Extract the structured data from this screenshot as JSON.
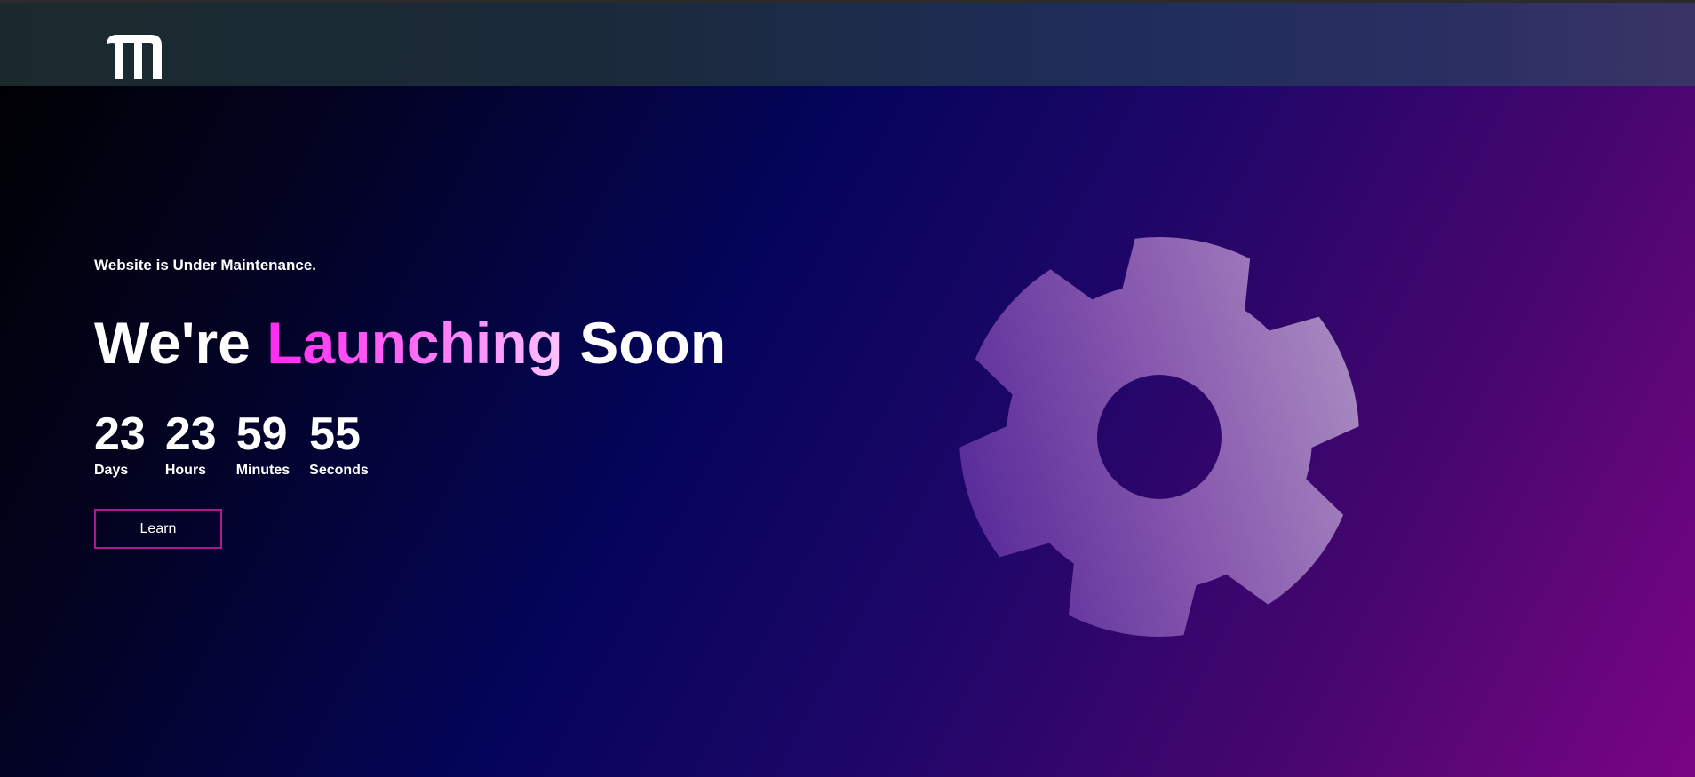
{
  "header": {
    "logo_letter": "m"
  },
  "hero": {
    "tagline": "Website is Under Maintenance.",
    "headline_before": "We're ",
    "headline_accent": "Launching",
    "headline_after": " Soon"
  },
  "countdown": {
    "days": "23",
    "days_label": "Days",
    "hours": "23",
    "hours_label": "Hours",
    "minutes": "59",
    "minutes_label": "Minutes",
    "seconds": "55",
    "seconds_label": "Seconds"
  },
  "actions": {
    "learn_label": "Learn"
  },
  "illustration": {
    "icon": "gear-icon"
  },
  "colors": {
    "accent": "#ff2af2",
    "button_border": "#b0168f",
    "gear_fill_start": "#5a2c9a",
    "gear_fill_end": "#a88ac0"
  }
}
